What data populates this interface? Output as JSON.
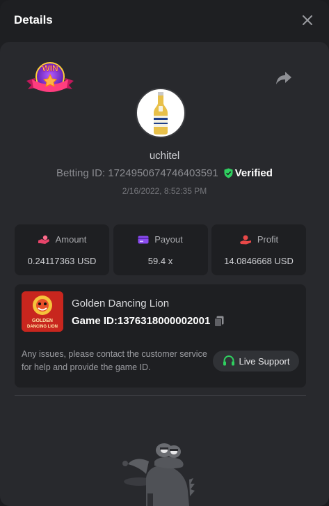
{
  "header": {
    "title": "Details"
  },
  "icons": {
    "close": "close-icon",
    "share": "share-icon",
    "verified": "shield-check-icon",
    "amount": "coins-hand-icon",
    "payout": "card-icon",
    "profit": "profit-hand-icon",
    "copy": "copy-icon",
    "support": "headset-icon"
  },
  "badge": {
    "text": "WIN"
  },
  "player": {
    "username": "uchitel",
    "betting_id": "Betting ID: 1724950674746403591",
    "verified_label": "Verified",
    "datetime": "2/16/2022, 8:52:35 PM"
  },
  "stats": [
    {
      "label": "Amount",
      "value": "0.24117363 USD",
      "icon": "coins-hand-icon",
      "color": "#e8446a"
    },
    {
      "label": "Payout",
      "value": "59.4 x",
      "icon": "card-icon",
      "color": "#8a4bf0"
    },
    {
      "label": "Profit",
      "value": "14.0846668 USD",
      "icon": "profit-hand-icon",
      "color": "#e84848"
    }
  ],
  "game": {
    "thumb_line1": "GOLDEN",
    "thumb_line2": "DANCING LION",
    "name": "Golden Dancing Lion",
    "game_id": "Game ID:1376318000002001",
    "support_text": "Any issues, please contact the customer service for help and provide the game ID.",
    "support_button": "Live Support"
  },
  "colors": {
    "background": "#1e1f22",
    "card": "#28292d",
    "verified_green": "#2fcf5f",
    "support_green": "#2fcf5f"
  }
}
